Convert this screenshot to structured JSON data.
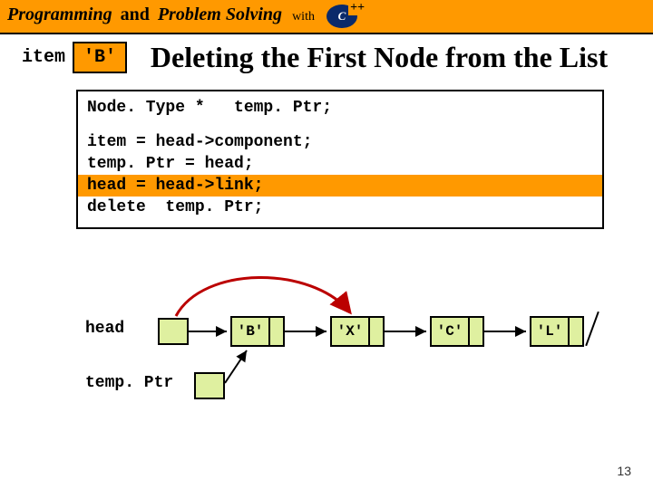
{
  "brand": {
    "w1": "Programming",
    "amp": "and",
    "w2": "Problem Solving",
    "with": "with",
    "cpp": "C",
    "plus": "++"
  },
  "title": "Deleting the First Node from the List",
  "item_label": "item",
  "item_value": "'B'",
  "code": {
    "decl": "Node. Type *   temp. Ptr;",
    "l1": "item = head->component;",
    "l2": "temp. Ptr = head;",
    "l3": "head = head->link;",
    "l4": "delete  temp. Ptr;"
  },
  "diagram": {
    "head_label": "head",
    "temp_label": "temp. Ptr",
    "nodes": [
      "'B'",
      "'X'",
      "'C'",
      "'L'"
    ]
  },
  "page_number": "13",
  "chart_data": {
    "type": "diagram",
    "title": "Deleting the First Node from the List",
    "description": "Singly-linked list with four nodes B, X, C, L. Pointer 'head' initially points to node B but is being reassigned to node X (shown by a red curved arrow from head to X). Pointer 'temp. Ptr' points to node B. The highlighted code line is 'head = head->link;'. The last node L has a null terminator slash.",
    "nodes": [
      {
        "value": "B",
        "next": "X"
      },
      {
        "value": "X",
        "next": "C"
      },
      {
        "value": "C",
        "next": "L"
      },
      {
        "value": "L",
        "next": null
      }
    ],
    "pointers": {
      "head": "B (reassigning to X)",
      "tempPtr": "B"
    },
    "highlighted_step": "head = head->link;"
  }
}
